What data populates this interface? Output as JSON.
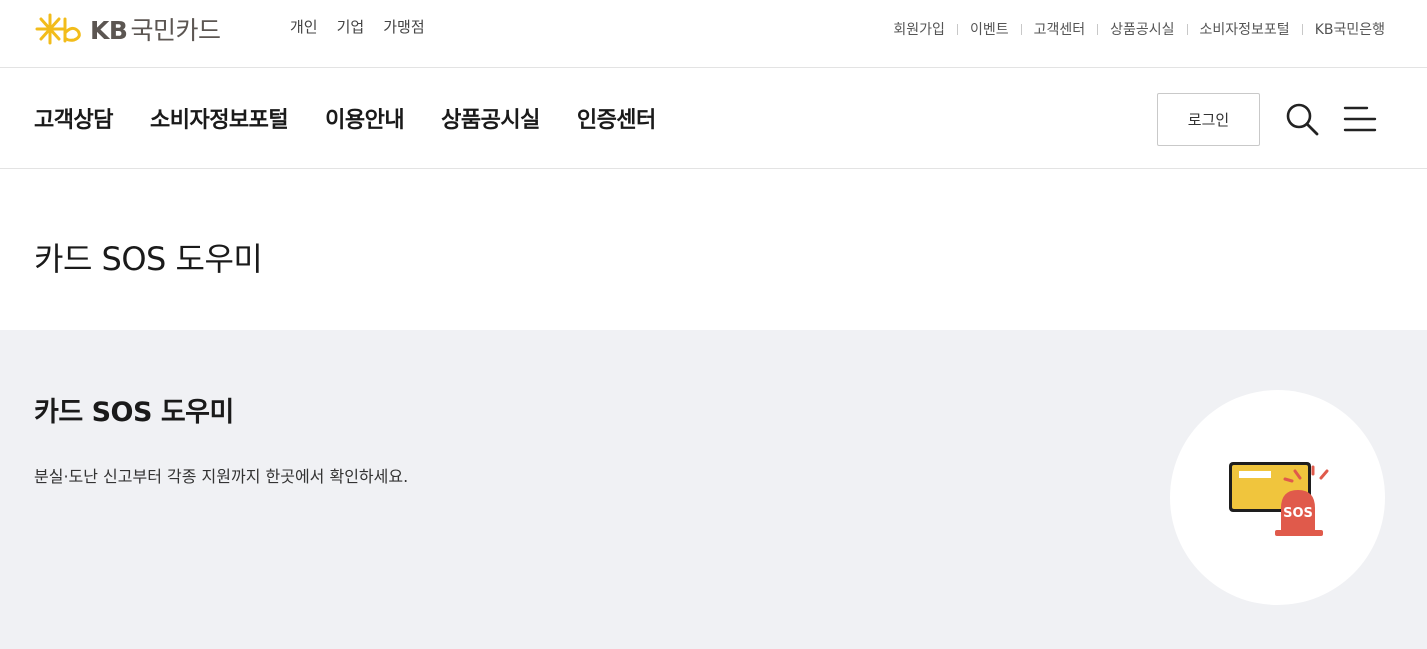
{
  "brand": {
    "logo_text_en": "KB",
    "logo_text_ko": "국민카드",
    "colors": {
      "logo_yellow": "#f2bc1b",
      "logo_gray": "#5c5652"
    }
  },
  "scope_tabs": [
    "개인",
    "기업",
    "가맹점"
  ],
  "util_nav": [
    "회원가입",
    "이벤트",
    "고객센터",
    "상품공시실",
    "소비자정보포털",
    "KB국민은행"
  ],
  "gnb": {
    "items": [
      "고객상담",
      "소비자정보포털",
      "이용안내",
      "상품공시실",
      "인증센터"
    ],
    "login_label": "로그인",
    "search_icon": "search-icon",
    "menu_icon": "hamburger-menu-icon"
  },
  "page": {
    "title": "카드 SOS 도우미"
  },
  "section": {
    "title": "카드 SOS 도우미",
    "description": "분실·도난 신고부터 각종 지원까지 한곳에서 확인하세요.",
    "illustration_text": "SOS",
    "colors": {
      "background": "#f0f1f4",
      "card_yellow": "#f0c53d",
      "siren_red": "#e05a4b"
    }
  }
}
